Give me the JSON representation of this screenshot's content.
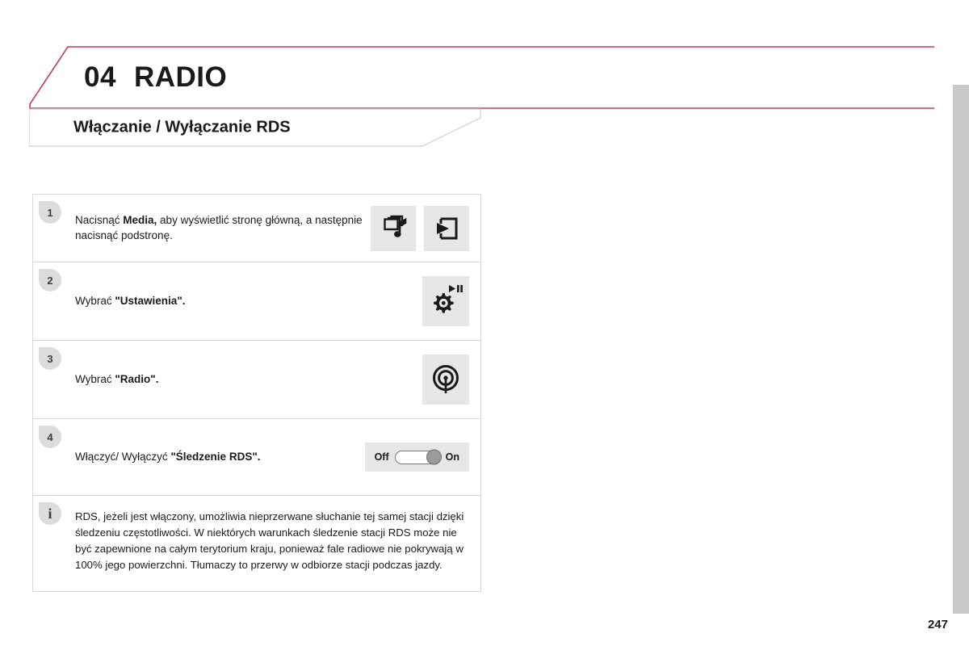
{
  "colors": {
    "accent": "#c8385a",
    "badge_bg": "#dcdcdc",
    "icon_bg": "#e6e6e6",
    "tab_gray": "#c9c9c9",
    "border": "#d8d8d8"
  },
  "chapter": {
    "number": "04",
    "title": "RADIO"
  },
  "section": {
    "title": "Włączanie / Wyłączanie RDS"
  },
  "steps": [
    {
      "badge": "1",
      "text_before": "Nacisnąć ",
      "text_bold": "Media,",
      "text_after": " aby wyświetlić stronę główną, a następnie nacisnąć podstronę.",
      "icons": [
        "media-music-icon",
        "subpage-enter-icon"
      ]
    },
    {
      "badge": "2",
      "text_before": "Wybrać ",
      "text_bold": "\"Ustawienia\".",
      "text_after": "",
      "icons": [
        "settings-gear-media-icon"
      ]
    },
    {
      "badge": "3",
      "text_before": "Wybrać ",
      "text_bold": "\"Radio\".",
      "text_after": "",
      "icons": [
        "radio-broadcast-icon"
      ]
    },
    {
      "badge": "4",
      "text_before": "Włączyć/ Wyłączyć ",
      "text_bold": "\"Śledzenie RDS\".",
      "text_after": "",
      "icons": [
        "toggle-switch"
      ]
    }
  ],
  "toggle": {
    "off_label": "Off",
    "on_label": "On",
    "state": "On"
  },
  "info": {
    "badge": "i",
    "text": "RDS, jeżeli jest włączony, umożliwia nieprzerwane słuchanie tej samej stacji dzięki śledzeniu częstotliwości. W niektórych warunkach śledzenie stacji RDS może nie być zapewnione na całym terytorium kraju, ponieważ fale radiowe nie pokrywają w 100% jego powierzchni. Tłumaczy to przerwy w odbiorze stacji podczas jazdy."
  },
  "footer": {
    "page_number": "247"
  }
}
